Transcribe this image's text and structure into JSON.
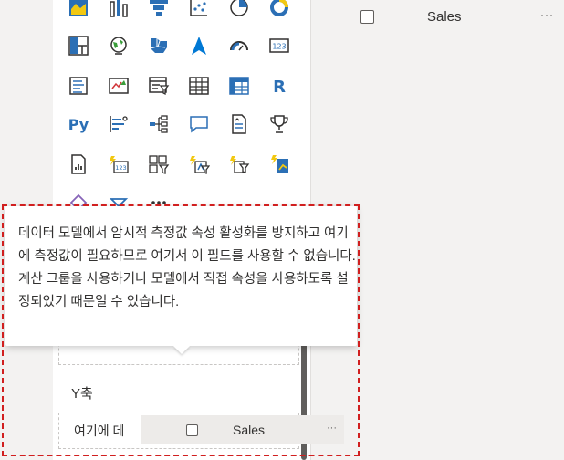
{
  "right_pane": {
    "field": {
      "label": "Sales",
      "more": "···"
    }
  },
  "viz_icons": [
    "filled-map-icon",
    "ribbon-chart-icon",
    "funnel-icon",
    "scatter-chart-icon",
    "pie-chart-icon",
    "donut-chart-icon",
    "treemap-icon",
    "map-globe-icon",
    "shape-map-icon",
    "azure-map-icon",
    "gauge-icon",
    "card-icon",
    "multi-row-card-icon",
    "kpi-icon",
    "slicer-icon",
    "table-icon",
    "matrix-icon",
    "r-visual-icon",
    "python-visual-icon",
    "key-influencers-icon",
    "decomposition-tree-icon",
    "qa-icon",
    "smart-narrative-icon",
    "trophy-goals-icon",
    "paginated-report-icon",
    "power-apps-card-icon",
    "power-apps-slicer-icon",
    "power-automate-icon",
    "power-apps-filter-icon",
    "power-flow-icon"
  ],
  "tooltip": {
    "text": "데이터 모델에서 암시적 측정값 속성 활성화를 방지하고 여기에 측정값이 필요하므로 여기서 이 필드를 사용할 수 없습니다. 계산 그룹을 사용하거나 모델에서 직접 속성을 사용하도록 설정되었기 때문일 수 있습니다."
  },
  "wells": {
    "y_axis_label": "Y축",
    "y_axis_placeholder": "여기에 데"
  },
  "drag_chip": {
    "label": "Sales",
    "more": "···"
  },
  "colors": {
    "highlight": "#d11f1f",
    "accent": "#0078d4",
    "icon_blue": "#2b6fb5",
    "icon_yellow": "#f2c811"
  }
}
